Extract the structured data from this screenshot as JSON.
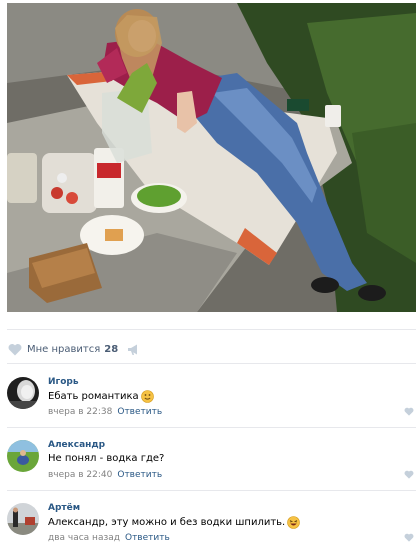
{
  "post": {
    "photo_icon": "photo-woman-picnic",
    "likes_label": "Мне нравится",
    "likes_count": "28",
    "share_icon": "megaphone-icon"
  },
  "comments": [
    {
      "author": "Игорь",
      "text": "Ебать романтика",
      "emoji": "grinning-emoji",
      "time": "вчера в 22:38",
      "reply": "Ответить"
    },
    {
      "author": "Александр",
      "text": "Не понял - водка где?",
      "emoji": "",
      "time": "вчера в 22:40",
      "reply": "Ответить"
    },
    {
      "author": "Артём",
      "text": "Александр, эту можно и без водки шпилить.",
      "emoji": "laughing-emoji",
      "time": "два часа назад",
      "reply": "Ответить"
    }
  ],
  "colors": {
    "link": "#2a5885",
    "meta": "#828282",
    "icon": "#c5d0db",
    "divider": "#e7e8ec"
  }
}
